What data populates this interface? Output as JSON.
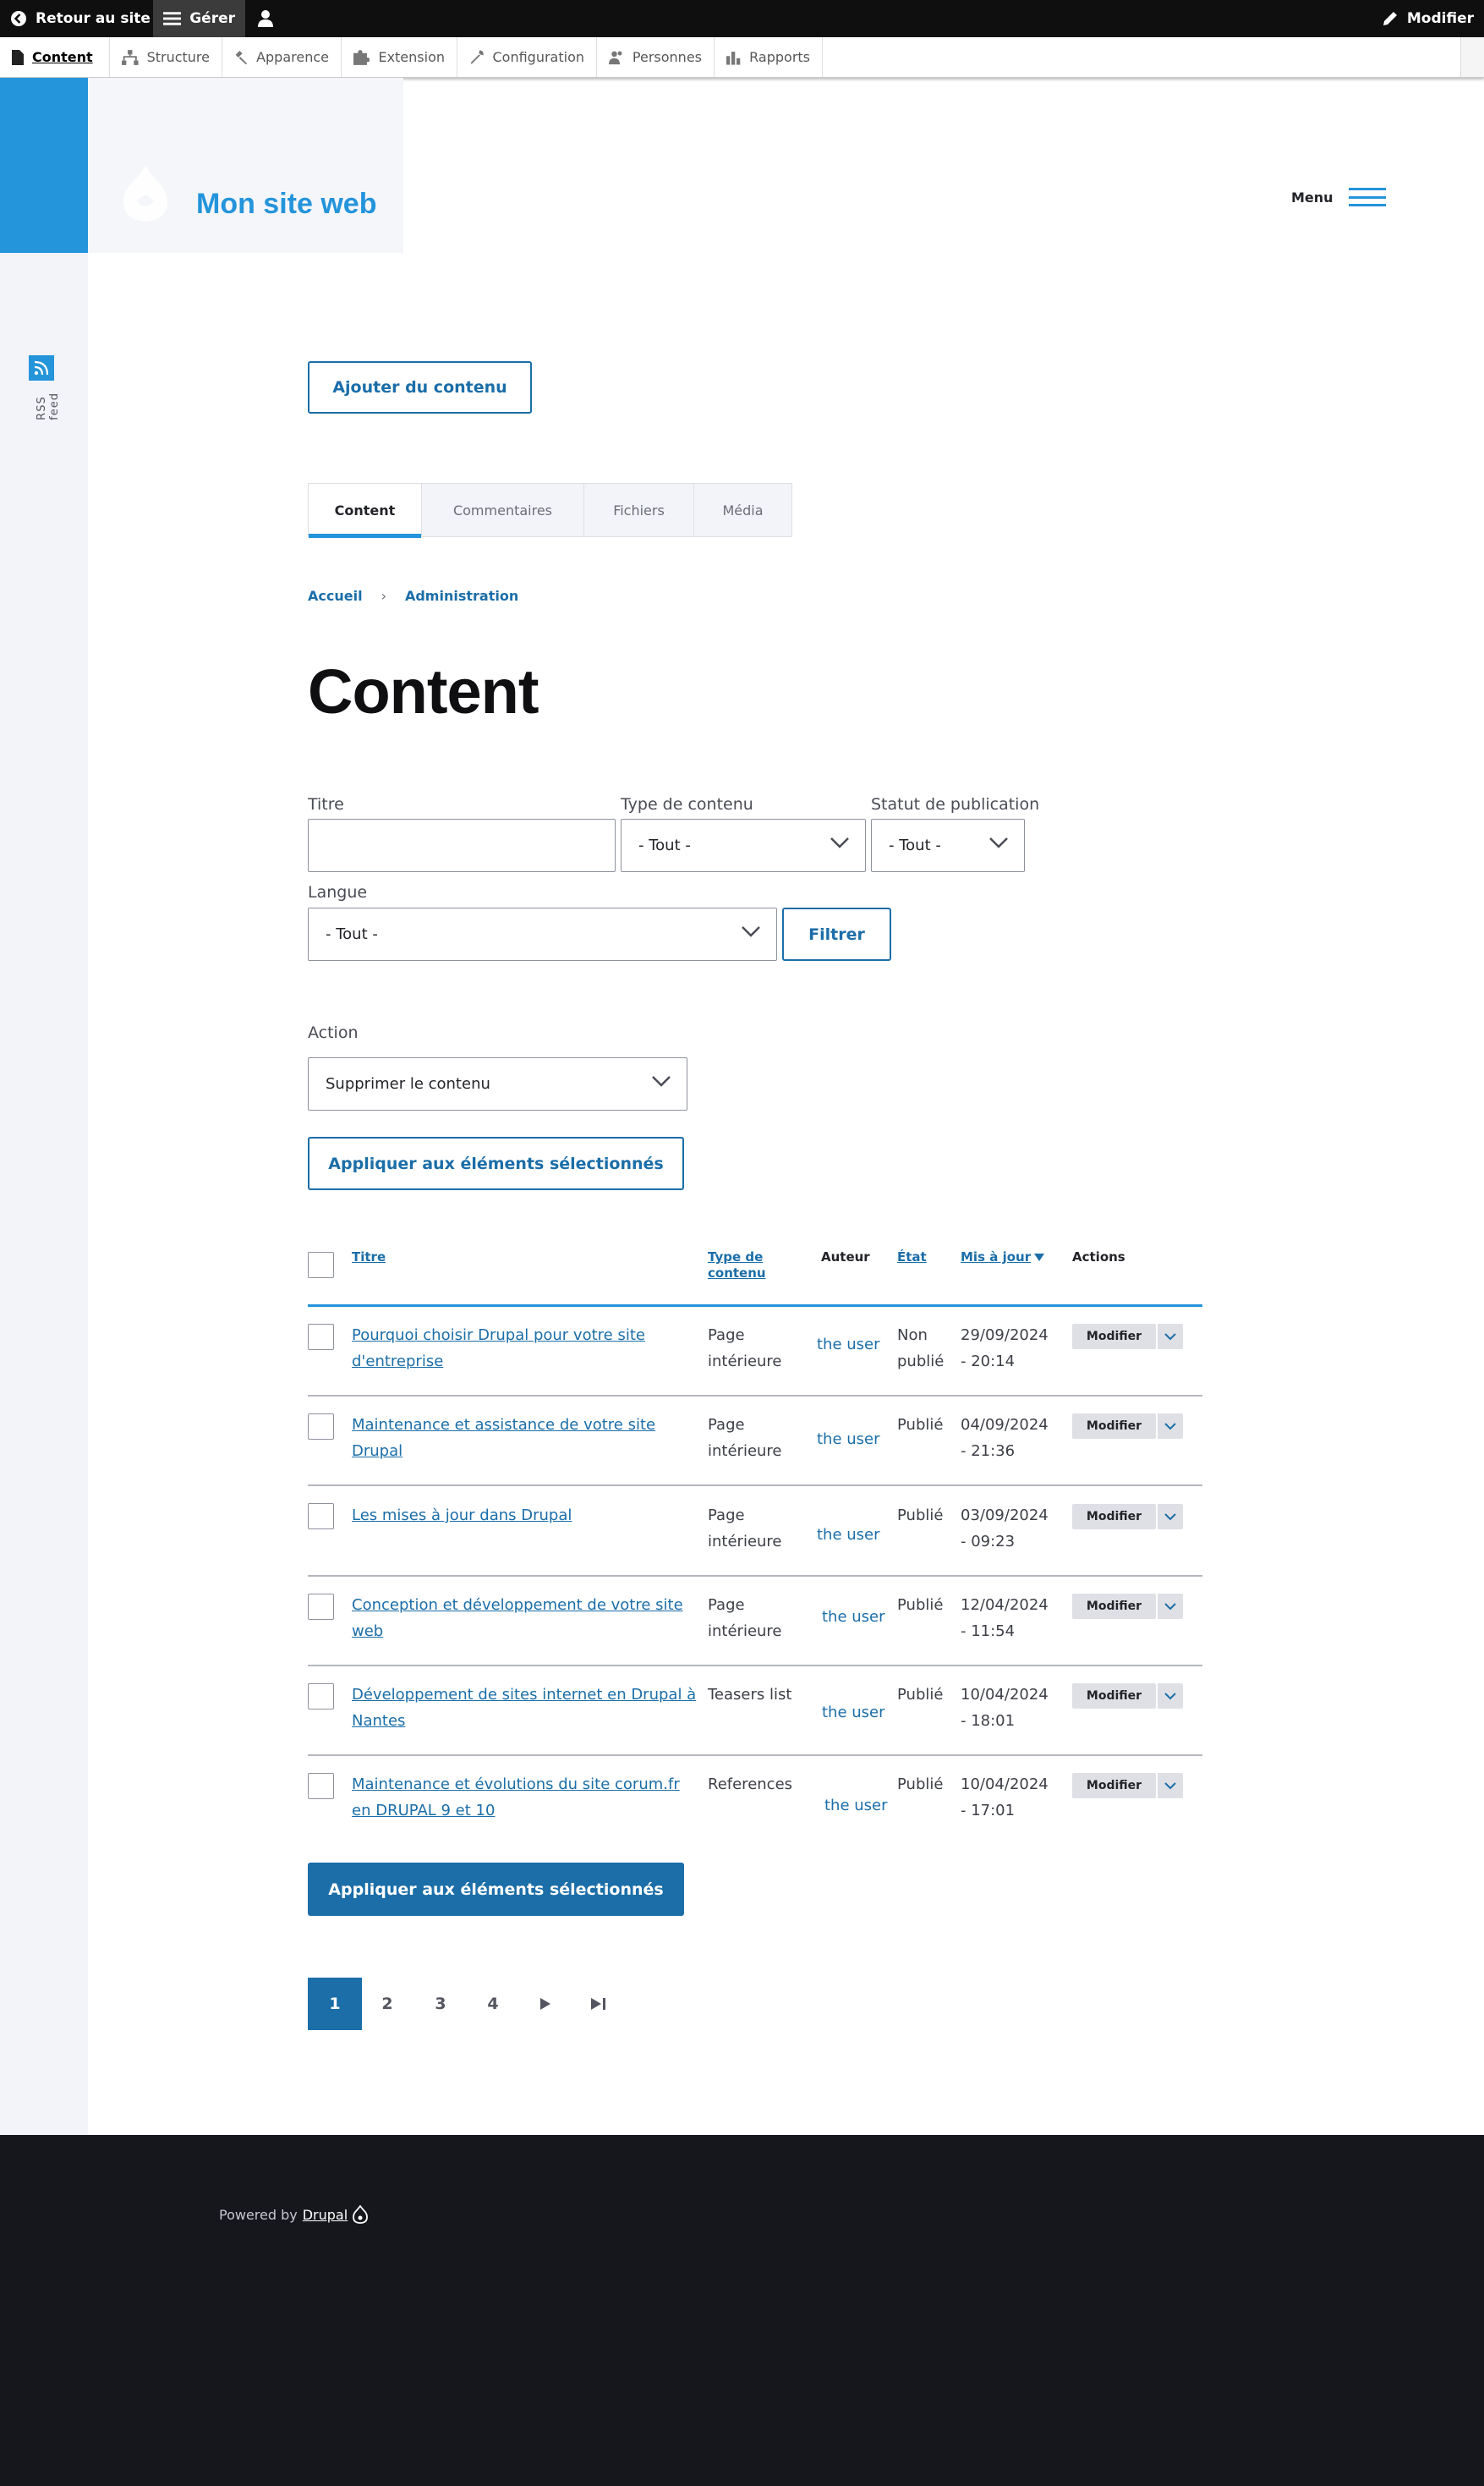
{
  "toolbar": {
    "back": "Retour au site",
    "manage": "Gérer",
    "edit": "Modifier"
  },
  "tray": [
    "Content",
    "Structure",
    "Apparence",
    "Extension",
    "Configuration",
    "Personnes",
    "Rapports"
  ],
  "site": {
    "name": "Mon site web",
    "menu": "Menu",
    "rss": "RSS feed"
  },
  "add_content": "Ajouter du contenu",
  "tabs": [
    "Content",
    "Commentaires",
    "Fichiers",
    "Média"
  ],
  "breadcrumb": [
    "Accueil",
    "Administration"
  ],
  "page_title": "Content",
  "filters": {
    "title_label": "Titre",
    "type_label": "Type de contenu",
    "type_value": "- Tout -",
    "status_label": "Statut de publication",
    "status_value": "- Tout -",
    "lang_label": "Langue",
    "lang_value": "- Tout -",
    "filter_btn": "Filtrer"
  },
  "action": {
    "label": "Action",
    "value": "Supprimer le contenu",
    "apply": "Appliquer aux éléments sélectionnés"
  },
  "table": {
    "headers": {
      "title": "Titre",
      "type_1": "Type de",
      "type_2": "contenu",
      "author": "Auteur",
      "state": "État",
      "updated": "Mis à jour",
      "actions": "Actions"
    },
    "rows": [
      {
        "title_1": "Pourquoi choisir Drupal pour votre site",
        "title_2": "d'entreprise",
        "type_1": "Page",
        "type_2": "intérieure",
        "author": "the user",
        "state_1": "Non",
        "state_2": "publié",
        "date_1": "29/09/2024",
        "date_2": "- 20:14",
        "action": "Modifier"
      },
      {
        "title_1": "Maintenance et assistance de votre site",
        "title_2": "Drupal",
        "type_1": "Page",
        "type_2": "intérieure",
        "author": "the user",
        "state_1": "Publié",
        "state_2": "",
        "date_1": "04/09/2024",
        "date_2": "- 21:36",
        "action": "Modifier"
      },
      {
        "title_1": "Les mises à jour dans Drupal",
        "title_2": "",
        "type_1": "Page",
        "type_2": "intérieure",
        "author": "the user",
        "state_1": "Publié",
        "state_2": "",
        "date_1": "03/09/2024",
        "date_2": "- 09:23",
        "action": "Modifier"
      },
      {
        "title_1": "Conception et développement de votre site",
        "title_2": "web",
        "type_1": "Page",
        "type_2": "intérieure",
        "author": "the user",
        "state_1": "Publié",
        "state_2": "",
        "date_1": "12/04/2024",
        "date_2": "- 11:54",
        "action": "Modifier"
      },
      {
        "title_1": "Développement de sites internet en Drupal à",
        "title_2": "Nantes",
        "type_1": "Teasers list",
        "type_2": "",
        "author": "the user",
        "state_1": "Publié",
        "state_2": "",
        "date_1": "10/04/2024",
        "date_2": "- 18:01",
        "action": "Modifier"
      },
      {
        "title_1": "Maintenance et évolutions du site corum.fr",
        "title_2": "en DRUPAL 9 et 10",
        "type_1": "References",
        "type_2": "",
        "author": "the user",
        "state_1": "Publié",
        "state_2": "",
        "date_1": "10/04/2024",
        "date_2": "- 17:01",
        "action": "Modifier"
      }
    ]
  },
  "pager": [
    "1",
    "2",
    "3",
    "4"
  ],
  "footer": {
    "powered": "Powered by",
    "drupal": "Drupal"
  },
  "colors": {
    "accent": "#2494db",
    "button": "#1b6ea8",
    "footer": "#16171d"
  }
}
